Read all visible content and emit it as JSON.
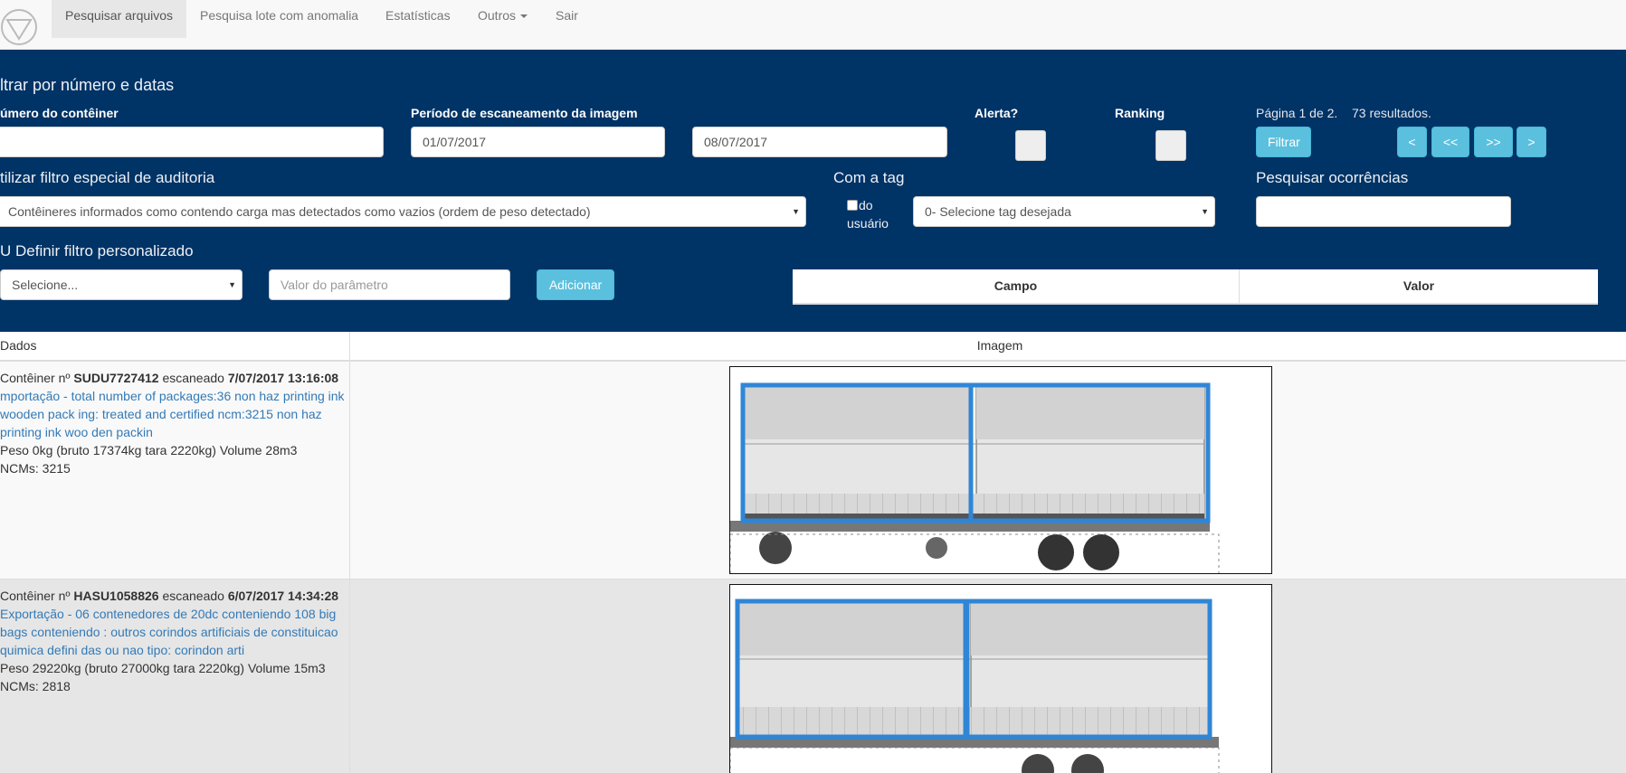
{
  "nav": {
    "logo_icon": "triangle-in-circle-logo",
    "items": [
      {
        "label": "Pesquisar arquivos",
        "active": true
      },
      {
        "label": "Pesquisa lote com anomalia"
      },
      {
        "label": "Estatísticas"
      },
      {
        "label": "Outros"
      },
      {
        "label": "Sair"
      }
    ]
  },
  "filters": {
    "section_title": "ltrar por número e datas",
    "container_number_label": "úmero do contêiner",
    "container_number_value": "",
    "scan_period_label": "Período de escaneamento da imagem",
    "date_start": "01/07/2017",
    "date_end": "08/07/2017",
    "alert_label": "Alerta?",
    "ranking_label": "Ranking",
    "pagination_text": "Página 1 de 2.",
    "results_text": "73 resultados.",
    "filter_button": "Filtrar",
    "page_buttons": [
      "<",
      "<<",
      ">>",
      ">"
    ],
    "audit_label": "tilizar filtro especial de auditoria",
    "audit_select": "Contêineres informados como contendo carga mas detectados como vazios (ordem de peso detectado)",
    "tag_label": "Com a tag",
    "user_check_label_1": "do",
    "user_check_label_2": "usuário",
    "tag_select": "0- Selecione tag desejada",
    "search_occurrences_label": "Pesquisar ocorrências",
    "search_occurrences_value": "",
    "custom_filter_label": "U Definir filtro personalizado",
    "custom_select": "Selecione...",
    "param_placeholder": "Valor do parâmetro",
    "add_button": "Adicionar",
    "table_headers": [
      "Campo",
      "Valor"
    ]
  },
  "results": {
    "headers": [
      "Dados",
      "Imagem"
    ],
    "rows": [
      {
        "prefix": "Contêiner nº",
        "container": "SUDU7727412",
        "scanned_word": "escaneado",
        "datetime": "7/07/2017 13:16:08",
        "desc_lines": [
          "mportação - total number of packages:36 non haz printing ink",
          "wooden pack ing: treated and certified ncm:3215 non haz",
          "printing ink woo den packin"
        ],
        "weight": "Peso 0kg (bruto 17374kg tara 2220kg) Volume 28m3",
        "ncms": "NCMs: 3215"
      },
      {
        "prefix": "Contêiner nº",
        "container": "HASU1058826",
        "scanned_word": "escaneado",
        "datetime": "6/07/2017 14:34:28",
        "desc_lines": [
          "Exportação - 06 contenedores de 20dc conteniendo 108 big",
          "bags conteniendo : outros corindos artificiais de constituicao",
          "quimica defini das ou nao tipo: corindon arti"
        ],
        "weight": "Peso 29220kg (bruto 27000kg tara 2220kg) Volume 15m3",
        "ncms": "NCMs: 2818"
      }
    ]
  },
  "colors": {
    "panel_bg": "#003366",
    "button_info": "#5bc0de",
    "link": "#337ab7",
    "box_highlight": "#2f86d6"
  }
}
